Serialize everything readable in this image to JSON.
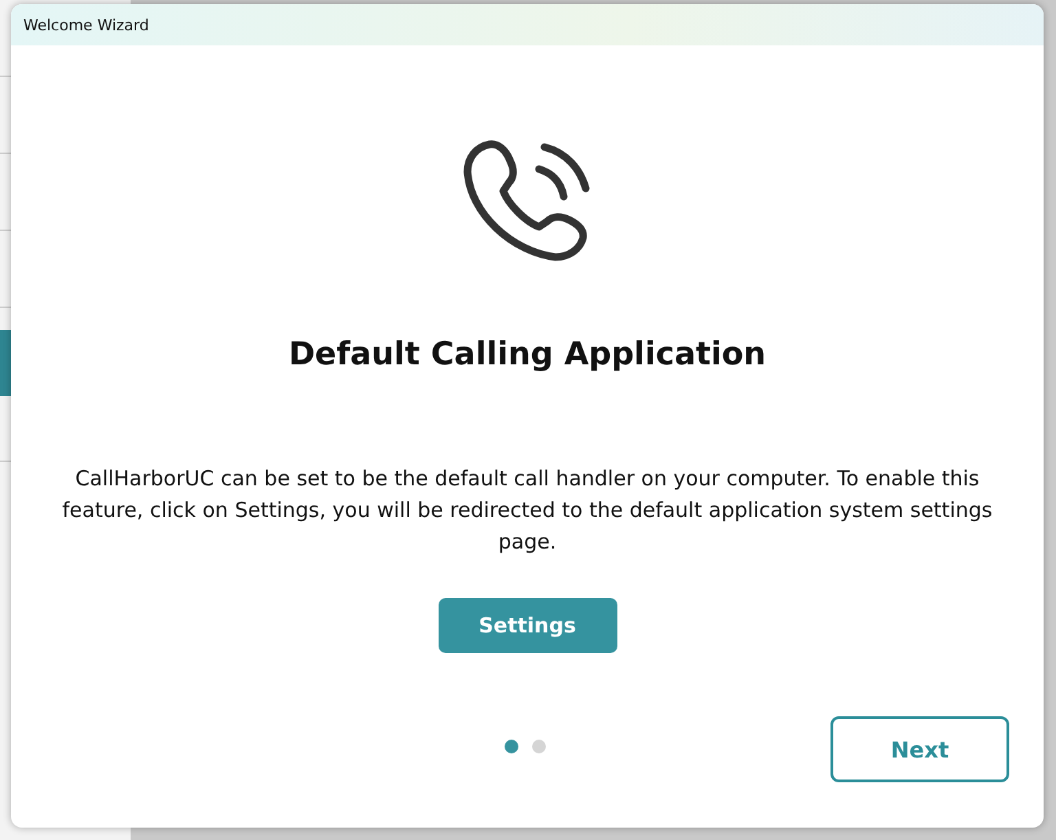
{
  "window": {
    "title": "Welcome Wizard"
  },
  "heading": "Default Calling Application",
  "description": "CallHarborUC can be set to be the default call handler on your computer. To enable this feature, click on Settings, you will be redirected to the default application system settings page.",
  "settings_button": "Settings",
  "pages": [
    {
      "selected": true
    },
    {
      "selected": false
    }
  ],
  "next_button": "Next"
}
